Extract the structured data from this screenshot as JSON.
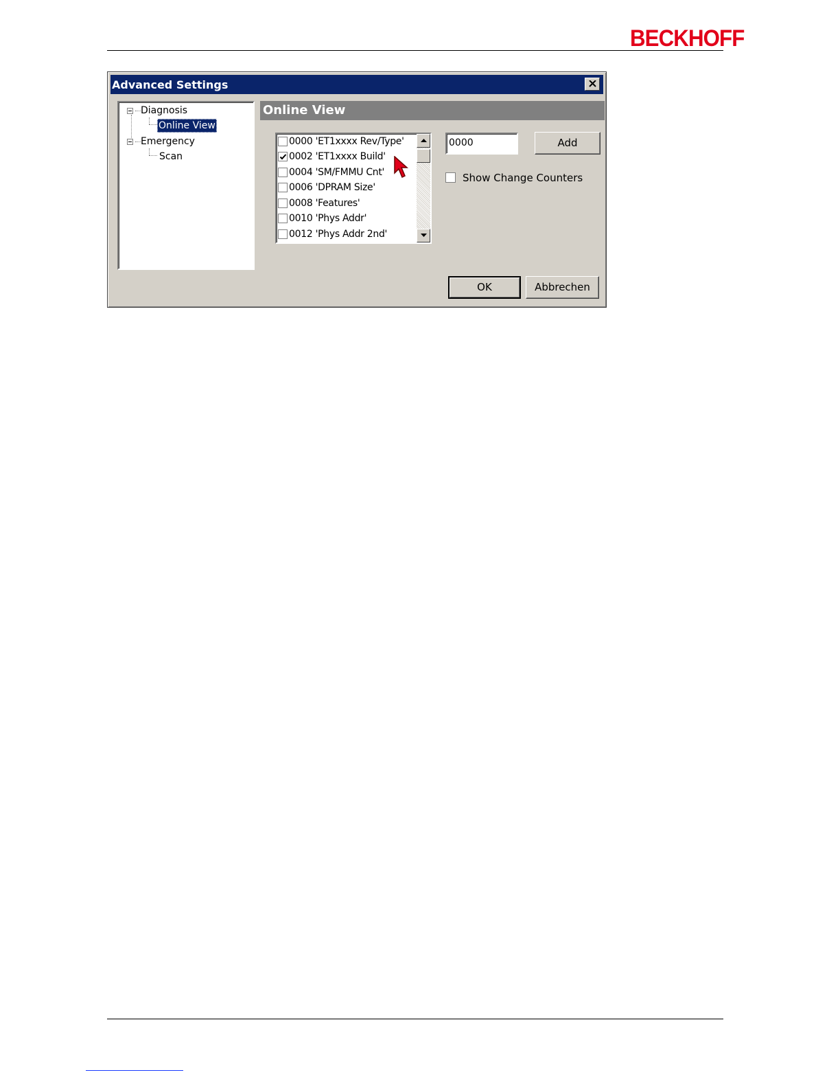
{
  "page": {
    "brand": "BECKHOFF",
    "colors": {
      "brand": "#e2001a",
      "titlebar": "#0a246a",
      "face": "#d4d0c8",
      "panel_header": "#808080"
    }
  },
  "dialog": {
    "title": "Advanced Settings",
    "close_icon": "close-icon",
    "tree": [
      {
        "label": "Diagnosis",
        "expanded": true,
        "children": [
          {
            "label": "Online View",
            "selected": true
          }
        ]
      },
      {
        "label": "Emergency",
        "expanded": true,
        "children": [
          {
            "label": "Scan",
            "selected": false
          }
        ]
      }
    ],
    "panel_title": "Online View",
    "register_list": [
      {
        "label": "0000 'ET1xxxx Rev/Type'",
        "checked": false
      },
      {
        "label": "0002 'ET1xxxx Build'",
        "checked": true
      },
      {
        "label": "0004 'SM/FMMU Cnt'",
        "checked": false
      },
      {
        "label": "0006 'DPRAM Size'",
        "checked": false
      },
      {
        "label": "0008 'Features'",
        "checked": false
      },
      {
        "label": "0010 'Phys Addr'",
        "checked": false
      },
      {
        "label": "0012 'Phys Addr 2nd'",
        "checked": false
      }
    ],
    "address_input": {
      "value": "0000"
    },
    "add_label": "Add",
    "show_change_counters": {
      "label": "Show Change Counters",
      "checked": false
    },
    "ok_label": "OK",
    "cancel_label": "Abbrechen"
  }
}
